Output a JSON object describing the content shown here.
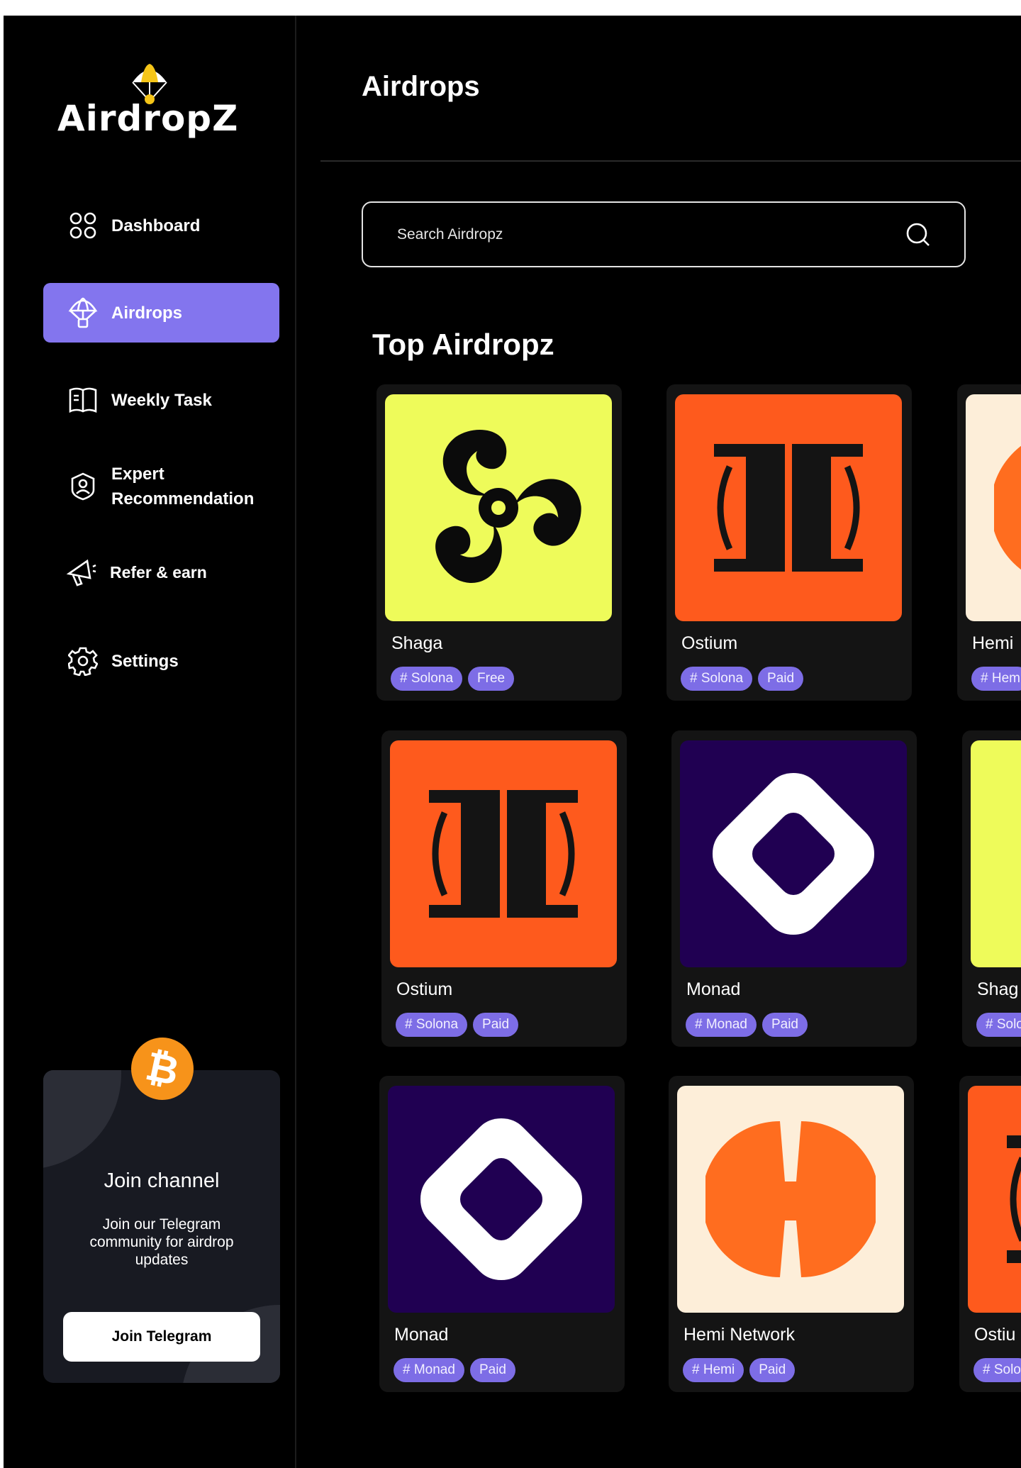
{
  "brand": {
    "logo_text": "AirdropZ"
  },
  "sidebar": {
    "items": [
      {
        "label": "Dashboard",
        "icon": "grid-icon"
      },
      {
        "label": "Airdrops",
        "icon": "parachute-icon",
        "active": true
      },
      {
        "label": "Weekly Task",
        "icon": "book-icon"
      },
      {
        "label": "Expert Recommendation",
        "icon": "user-badge-icon"
      },
      {
        "label": "Refer & earn",
        "icon": "megaphone-icon"
      },
      {
        "label": "Settings",
        "icon": "gear-icon"
      }
    ],
    "channel": {
      "icon": "bitcoin-icon",
      "title": "Join channel",
      "description": "Join our Telegram community for airdrop updates",
      "button_label": "Join Telegram"
    }
  },
  "header": {
    "title": "Airdrops"
  },
  "search": {
    "placeholder": "Search Airdropz",
    "value": ""
  },
  "section": {
    "title": "Top Airdropz"
  },
  "cards": [
    {
      "name": "Shaga",
      "tags": [
        "# Solona",
        "Free"
      ],
      "logo": "shaga"
    },
    {
      "name": "Ostium",
      "tags": [
        "# Solona",
        "Paid"
      ],
      "logo": "ostium"
    },
    {
      "name": "Hemi",
      "tags": [
        "# Hem"
      ],
      "logo": "hemi"
    },
    {
      "name": "Ostium",
      "tags": [
        "# Solona",
        "Paid"
      ],
      "logo": "ostium"
    },
    {
      "name": "Monad",
      "tags": [
        "# Monad",
        "Paid"
      ],
      "logo": "monad"
    },
    {
      "name": "Shag",
      "tags": [
        "# Solo"
      ],
      "logo": "shaga"
    },
    {
      "name": "Monad",
      "tags": [
        "# Monad",
        "Paid"
      ],
      "logo": "monad"
    },
    {
      "name": "Hemi Network",
      "tags": [
        "# Hemi",
        "Paid"
      ],
      "logo": "hemi"
    },
    {
      "name": "Ostiu",
      "tags": [
        "# Solo"
      ],
      "logo": "ostium"
    }
  ],
  "colors": {
    "accent": "#8375ee",
    "tag": "#7d6de6",
    "shaga_bg": "#eefb5a",
    "ostium_bg": "#fe5a1d",
    "monad_bg": "#200052",
    "hemi_bg": "#fdeed9",
    "hemi_fg": "#ff6d1f",
    "bitcoin": "#f7931a"
  }
}
